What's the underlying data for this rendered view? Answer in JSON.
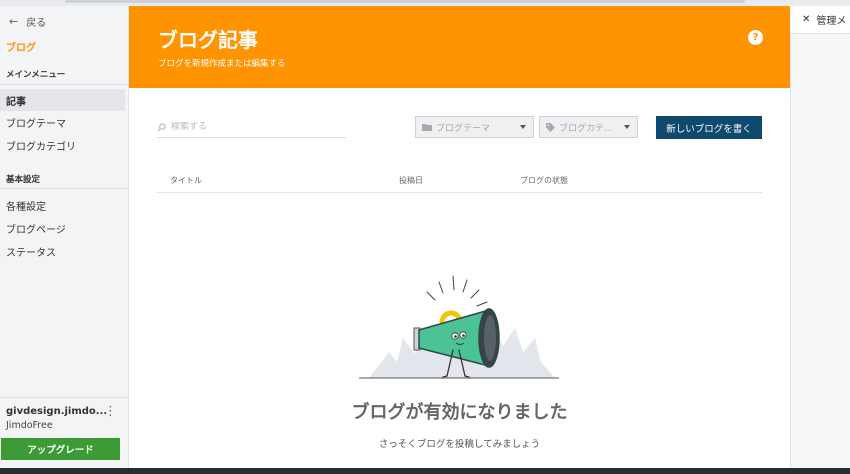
{
  "sidebar": {
    "back_label": "戻る",
    "brand": "ブログ",
    "main_menu_label": "メインメニュー",
    "main_items": [
      {
        "label": "記事"
      },
      {
        "label": "ブログテーマ"
      },
      {
        "label": "ブログカテゴリ"
      }
    ],
    "basic_settings_label": "基本設定",
    "basic_items": [
      {
        "label": "各種設定"
      },
      {
        "label": "ブログページ"
      },
      {
        "label": "ステータス"
      }
    ],
    "account_name": "givdesign.jimdo...",
    "plan": "JimdoFree",
    "upgrade_label": "アップグレード"
  },
  "header": {
    "title": "ブログ記事",
    "subtitle": "ブログを新規作成または編集する",
    "help_label": "?"
  },
  "toolbar": {
    "search_placeholder": "検索する",
    "theme_select": "ブログテーマ",
    "category_select": "ブログカテ...",
    "new_post_label": "新しいブログを書く"
  },
  "table": {
    "columns": [
      "タイトル",
      "投稿日",
      "ブログの状態"
    ]
  },
  "empty_state": {
    "title": "ブログが有効になりました",
    "subtitle": "さっそくブログを投稿してみましょう"
  },
  "right_panel": {
    "close_label": "管理メ"
  },
  "colors": {
    "accent": "#ff9300",
    "primary_button": "#0e4a6e",
    "upgrade_button": "#3d9b35"
  }
}
